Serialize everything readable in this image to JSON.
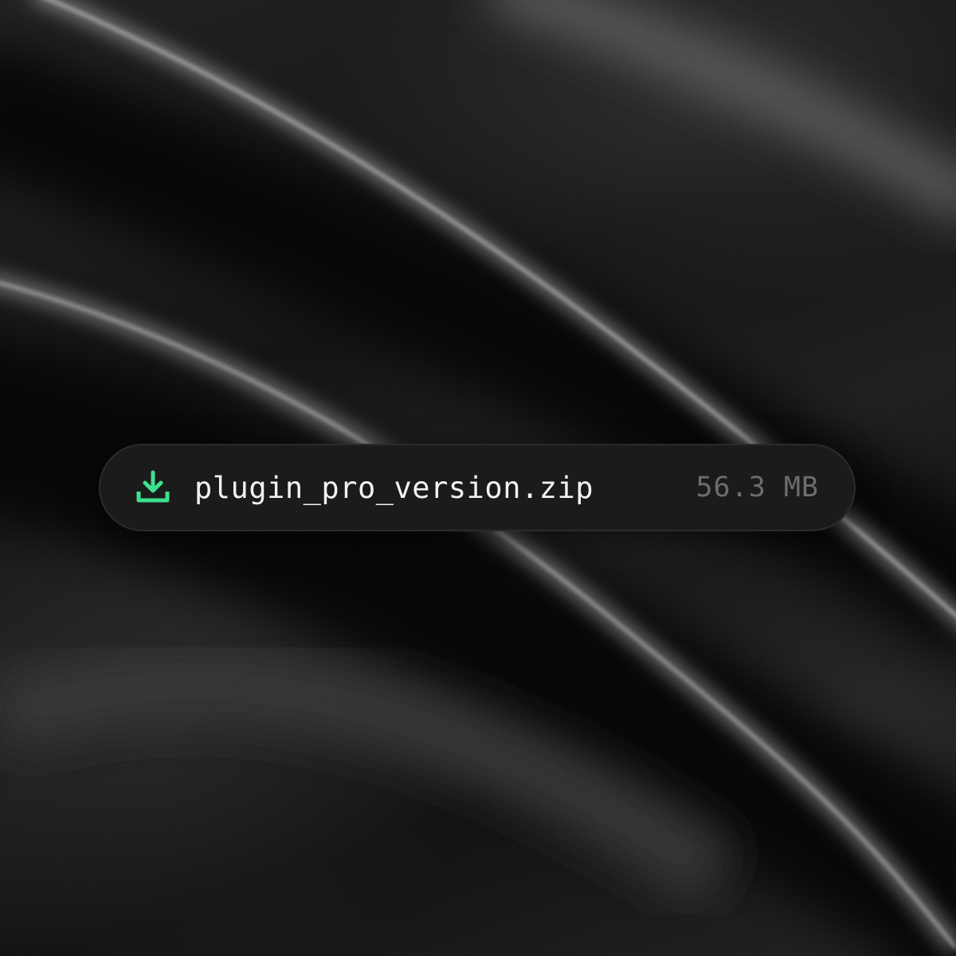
{
  "download": {
    "file_name": "plugin_pro_version.zip",
    "file_size": "56.3 MB",
    "icon": "download-icon"
  },
  "colors": {
    "accent": "#3ee08f",
    "pill_background": "#1b1b1b",
    "file_name_text": "#f2f2f2",
    "file_size_text": "#6d6d6d"
  }
}
